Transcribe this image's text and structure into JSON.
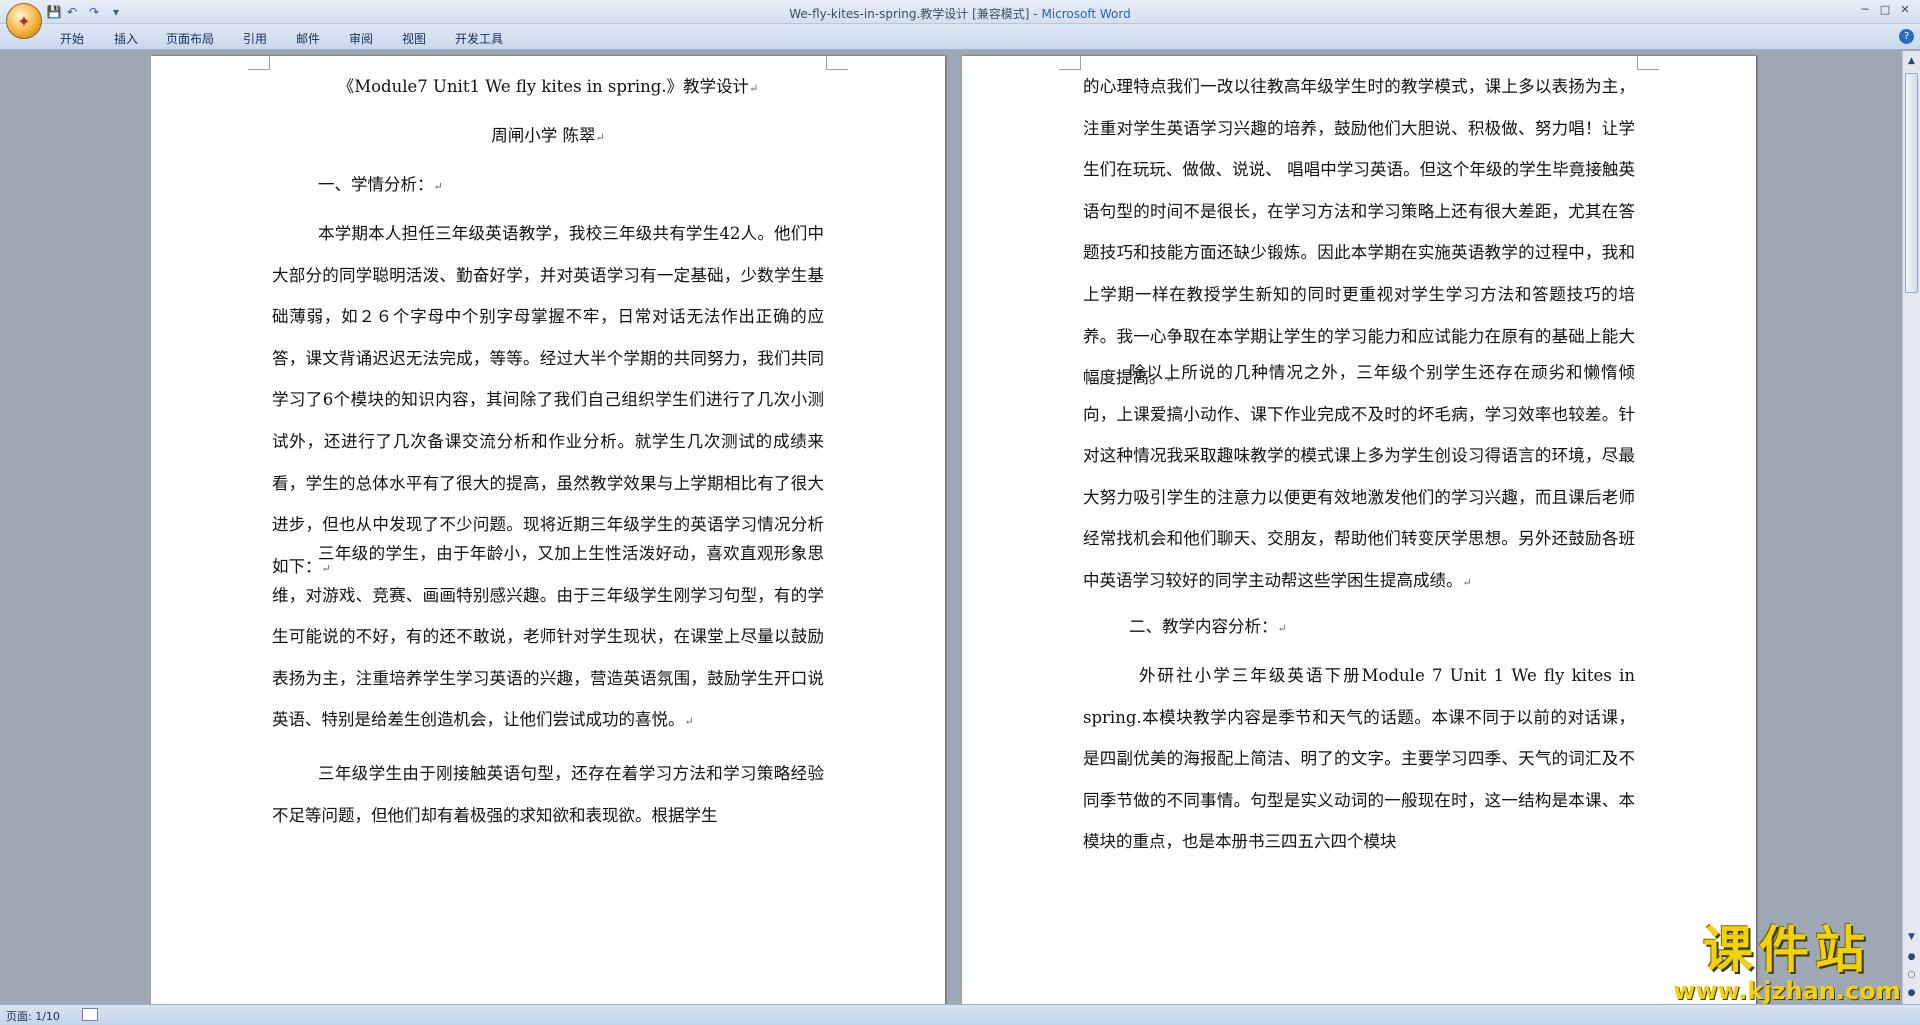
{
  "window": {
    "title_prefix": "We-fly-kites-in-spring.教学设计 [兼容模式] - ",
    "title_app": "Microsoft Word",
    "office_button_glyph": "✦",
    "quick_access": {
      "save": "💾",
      "undo": "↶",
      "redo": "↷",
      "customize": "▾"
    },
    "controls": {
      "minimize": "─",
      "maximize": "□",
      "close": "✕"
    }
  },
  "ribbon": {
    "tabs": [
      "开始",
      "插入",
      "页面布局",
      "引用",
      "邮件",
      "审阅",
      "视图",
      "开发工具"
    ],
    "help": "?"
  },
  "document": {
    "page1": {
      "title": "《Module7 Unit1 We fly kites in spring.》教学设计",
      "author_line": "周闸小学      陈翠",
      "heading1": "一、学情分析：",
      "para1": "本学期本人担任三年级英语教学，我校三年级共有学生42人。他们中大部分的同学聪明活泼、勤奋好学，并对英语学习有一定基础，少数学生基础薄弱，如２６个字母中个别字母掌握不牢，日常对话无法作出正确的应答，课文背诵迟迟无法完成，等等。经过大半个学期的共同努力，我们共同学习了6个模块的知识内容，其间除了我们自己组织学生们进行了几次小测试外，还进行了几次备课交流分析和作业分析。就学生几次测试的成绩来看，学生的总体水平有了很大的提高，虽然教学效果与上学期相比有了很大进步，但也从中发现了不少问题。现将近期三年级学生的英语学习情况分析如下：",
      "para2": "三年级的学生，由于年龄小，又加上生性活泼好动，喜欢直观形象思维，对游戏、竞赛、画画特别感兴趣。由于三年级学生刚学习句型，有的学生可能说的不好，有的还不敢说，老师针对学生现状，在课堂上尽量以鼓励表扬为主，注重培养学生学习英语的兴趣，营造英语氛围，鼓励学生开口说英语、特别是给差生创造机会，让他们尝试成功的喜悦。",
      "para3": "三年级学生由于刚接触英语句型，还存在着学习方法和学习策略经验不足等问题，但他们却有着极强的求知欲和表现欲。根据学生"
    },
    "page2": {
      "para1": "的心理特点我们一改以往教高年级学生时的教学模式，课上多以表扬为主，注重对学生英语学习兴趣的培养，鼓励他们大胆说、积极做、努力唱！让学生们在玩玩、做做、说说、 唱唱中学习英语。但这个年级的学生毕竟接触英语句型的时间不是很长，在学习方法和学习策略上还有很大差距，尤其在答题技巧和技能方面还缺少锻炼。因此本学期在实施英语教学的过程中，我和上学期一样在教授学生新知的同时更重视对学生学习方法和答题技巧的培养。我一心争取在本学期让学生的学习能力和应试能力在原有的基础上能大幅度提高。",
      "para2": "除以上所说的几种情况之外，三年级个别学生还存在顽劣和懒惰倾向，上课爱搞小动作、课下作业完成不及时的坏毛病，学习效率也较差。针对这种情况我采取趣味教学的模式课上多为学生创设习得语言的环境，尽最大努力吸引学生的注意力以便更有效地激发他们的学习兴趣，而且课后老师经常找机会和他们聊天、交朋友，帮助他们转变厌学思想。另外还鼓励各班中英语学习较好的同学主动帮这些学困生提高成绩。",
      "heading2": "二、教学内容分析：",
      "para3": "外研社小学三年级英语下册Module 7 Unit 1  We fly kites in spring.本模块教学内容是季节和天气的话题。本课不同于以前的对话课，是四副优美的海报配上简洁、明了的文字。主要学习四季、天气的词汇及不同季节做的不同事情。句型是实义动词的一般现在时，这一结构是本课、本模块的重点，也是本册书三四五六四个模块"
    },
    "paragraph_mark": "↵"
  },
  "statusbar": {
    "page_info": "页面: 1/10"
  },
  "watermark": {
    "main": "课件站",
    "url": "www.kjzhan.com"
  }
}
